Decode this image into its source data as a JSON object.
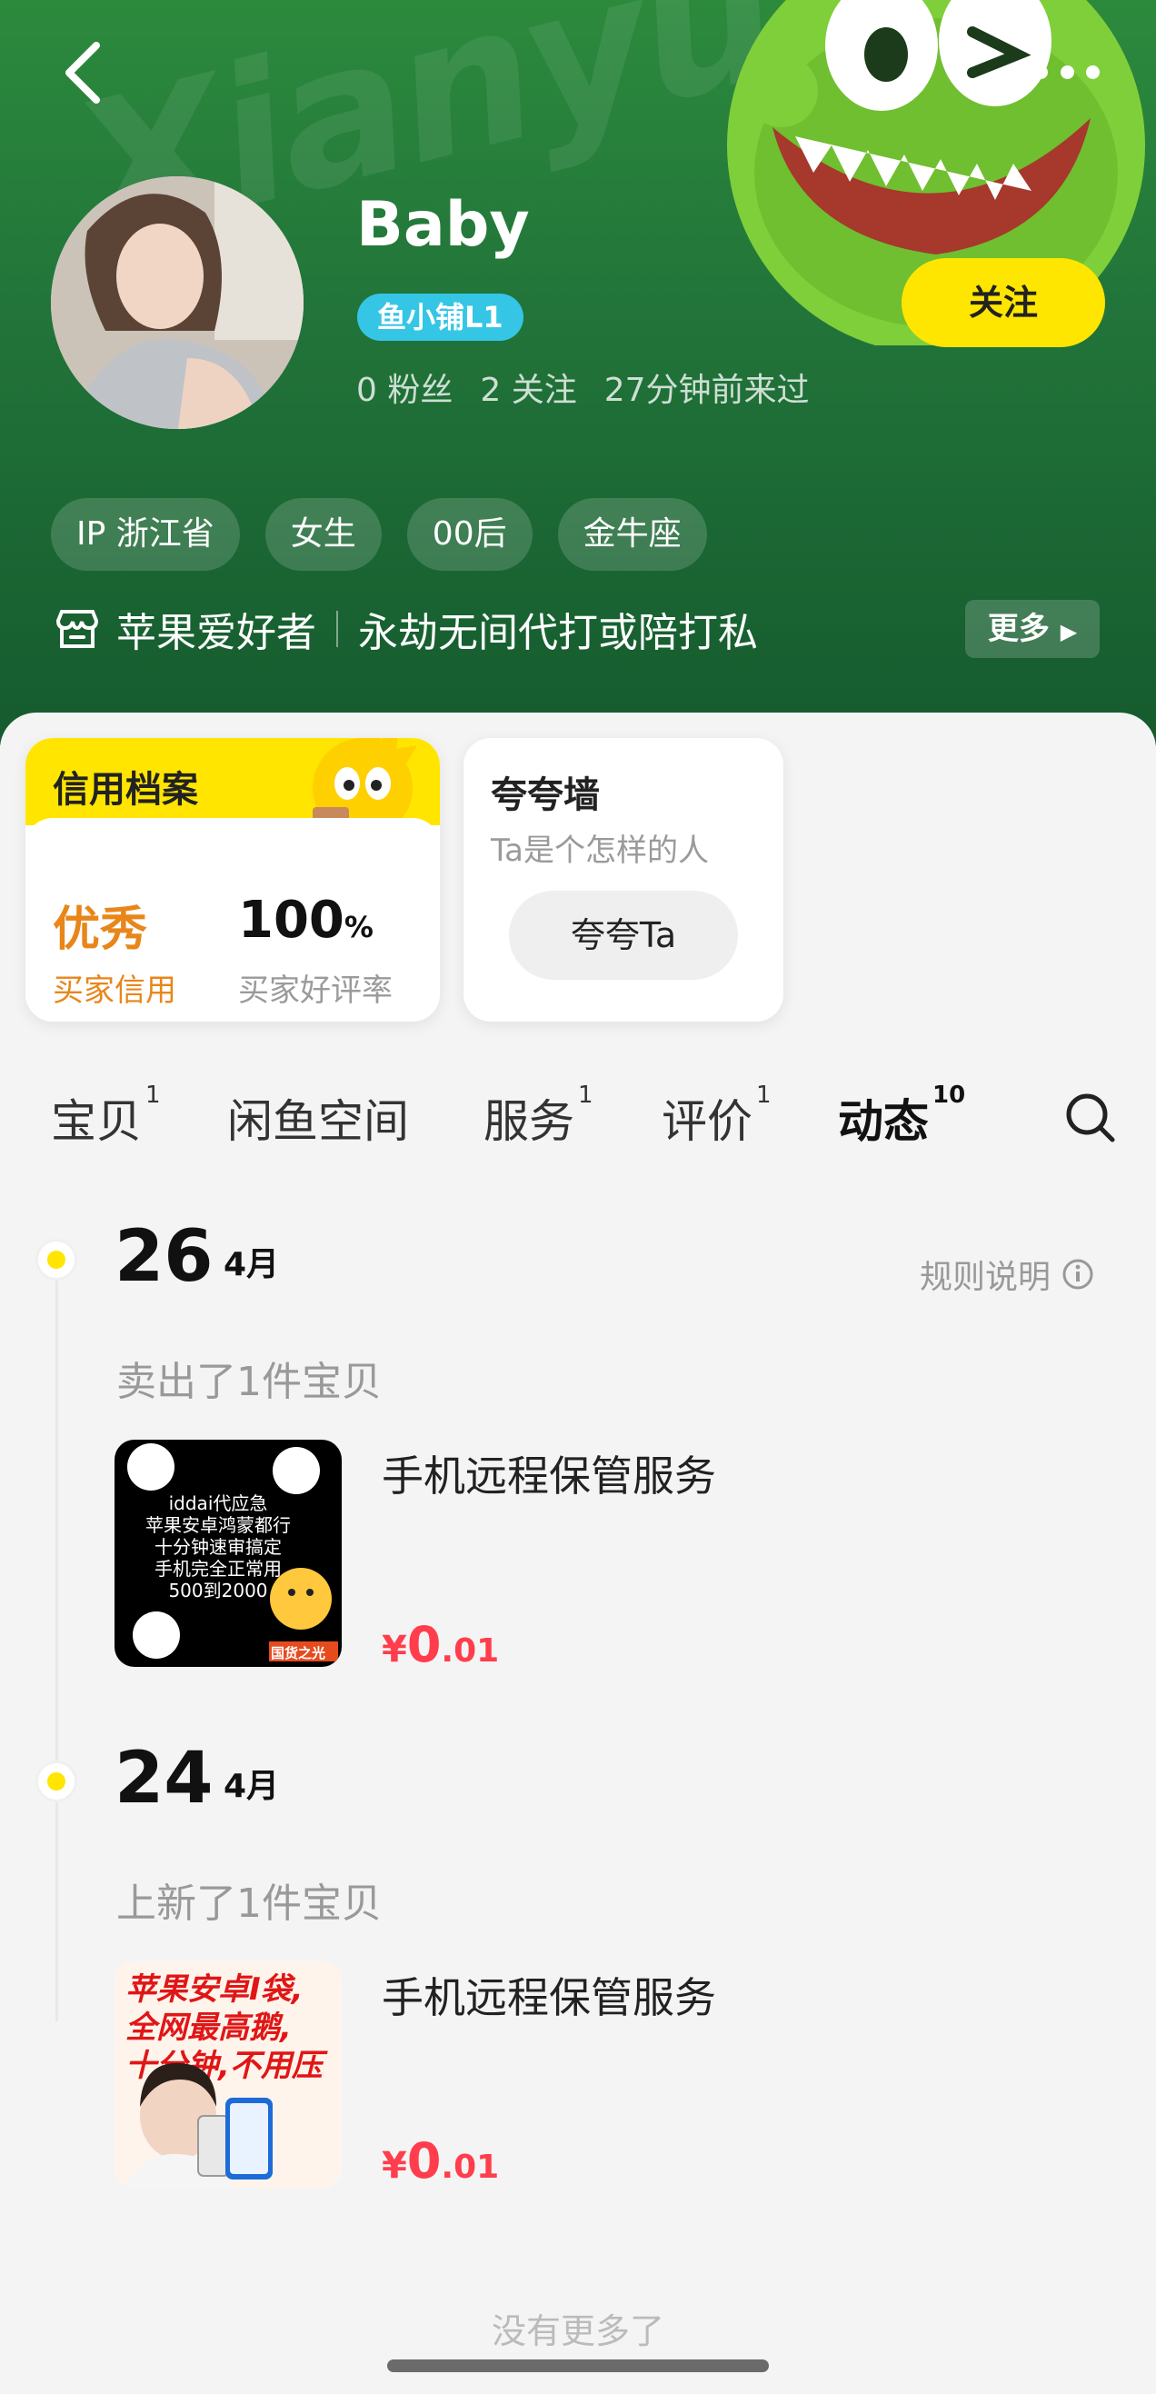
{
  "header": {
    "bg_text": "Xianyu",
    "name": "Baby",
    "level": "鱼小铺L1",
    "stats": [
      "0 粉丝",
      "2 关注",
      "27分钟前来过"
    ],
    "follow_label": "关注",
    "tags": [
      "IP 浙江省",
      "女生",
      "00后",
      "金牛座"
    ],
    "bio_part1": "苹果爱好者",
    "bio_part2": "永劫无间代打或陪打私",
    "more_label": "更多"
  },
  "credit": {
    "title": "信用档案",
    "rating": "优秀",
    "rating_label": "买家信用",
    "percent": "100",
    "percent_sign": "%",
    "percent_label": "买家好评率"
  },
  "praise": {
    "title": "夸夸墙",
    "subtitle": "Ta是个怎样的人",
    "button": "夸夸Ta"
  },
  "tabs": [
    {
      "label": "宝贝",
      "count": "1"
    },
    {
      "label": "闲鱼空间",
      "count": ""
    },
    {
      "label": "服务",
      "count": "1"
    },
    {
      "label": "评价",
      "count": "1"
    },
    {
      "label": "动态",
      "count": "10"
    }
  ],
  "timeline": {
    "rules_label": "规则说明",
    "entries": [
      {
        "day": "26",
        "month": "4月",
        "action": "卖出了1件宝贝",
        "item_title": "手机远程保管服务",
        "price_symbol": "¥",
        "price_int": "0",
        "price_dec": ".01",
        "thumb_lines": [
          "iddai代应急",
          "苹果安卓鸿蒙都行",
          "十分钟速审搞定",
          "手机完全正常用",
          "500到2000"
        ],
        "thumb_brand": "国货之光"
      },
      {
        "day": "24",
        "month": "4月",
        "action": "上新了1件宝贝",
        "item_title": "手机远程保管服务",
        "price_symbol": "¥",
        "price_int": "0",
        "price_dec": ".01",
        "thumb_lines": [
          "苹果安卓I袋,",
          "全网最高鹅,",
          "十分钟,不用压"
        ]
      }
    ],
    "no_more": "没有更多了"
  },
  "colors": {
    "accent_yellow": "#ffe500",
    "header_green": "#22753a",
    "price_red": "#ff3d4c",
    "credit_orange": "#e8861a"
  }
}
